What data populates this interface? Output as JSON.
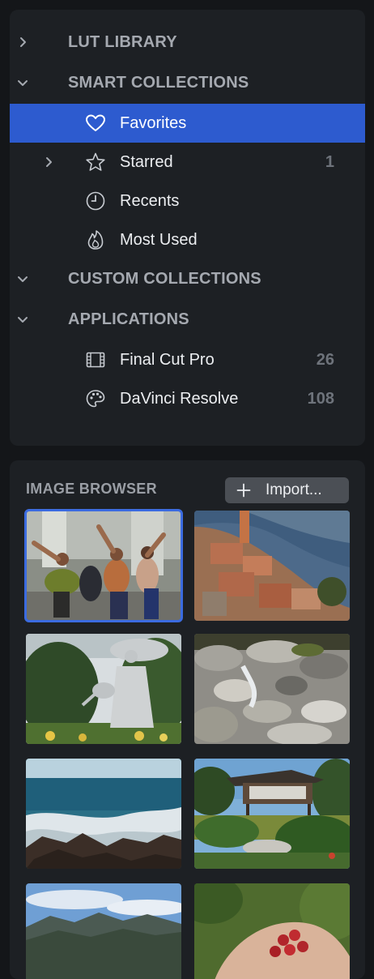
{
  "sidebar": {
    "sections": [
      {
        "label": "LUT LIBRARY",
        "expanded": false
      },
      {
        "label": "SMART COLLECTIONS",
        "expanded": true
      },
      {
        "label": "CUSTOM COLLECTIONS",
        "expanded": true
      },
      {
        "label": "APPLICATIONS",
        "expanded": true
      }
    ],
    "smart_items": [
      {
        "label": "Favorites",
        "icon": "heart-icon",
        "count": "",
        "selected": true
      },
      {
        "label": "Starred",
        "icon": "star-icon",
        "count": "1",
        "expandable": true
      },
      {
        "label": "Recents",
        "icon": "clock-icon",
        "count": ""
      },
      {
        "label": "Most Used",
        "icon": "flame-icon",
        "count": ""
      }
    ],
    "app_items": [
      {
        "label": "Final Cut Pro",
        "icon": "film-icon",
        "count": "26"
      },
      {
        "label": "DaVinci Resolve",
        "icon": "palette-icon",
        "count": "108"
      }
    ]
  },
  "browser": {
    "title": "IMAGE BROWSER",
    "import_label": "Import...",
    "thumbnails": [
      {
        "name": "dancers",
        "selected": true
      },
      {
        "name": "hillside-village"
      },
      {
        "name": "statue-garden"
      },
      {
        "name": "rocky-stream"
      },
      {
        "name": "sea-rocks"
      },
      {
        "name": "japanese-pavilion"
      },
      {
        "name": "mountains-sky"
      },
      {
        "name": "berries-in-hand"
      }
    ]
  },
  "colors": {
    "accent": "#2d5bcf",
    "panel": "#1d2024",
    "background": "#141619"
  }
}
